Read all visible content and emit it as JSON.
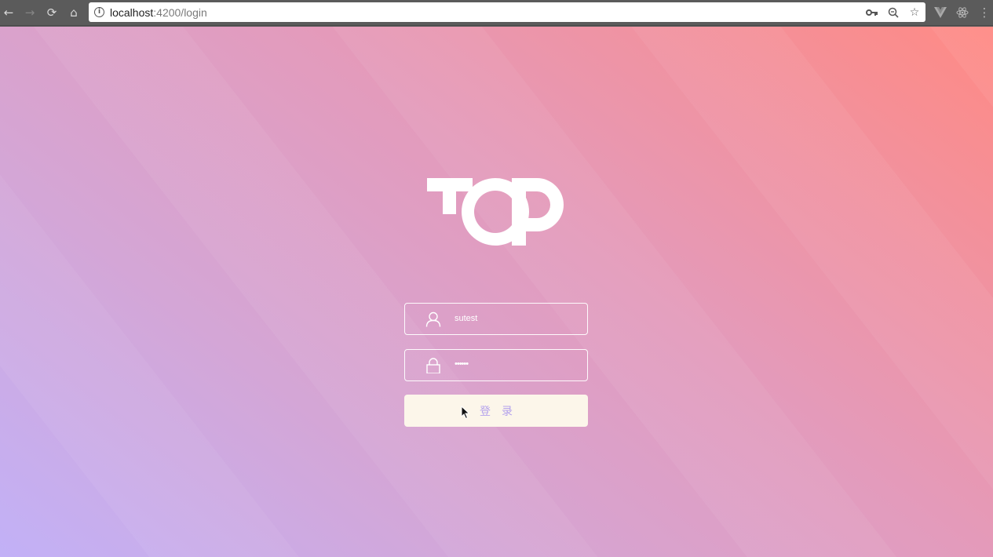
{
  "browser": {
    "url_host": "localhost",
    "url_path": ":4200/login",
    "back_icon": "arrow-left-icon",
    "forward_icon": "arrow-right-icon",
    "reload_icon": "reload-icon",
    "home_icon": "home-icon"
  },
  "login": {
    "logo_text": "TOP",
    "username": "sutest",
    "password_mask": "••••••",
    "submit_label": "登录"
  },
  "colors": {
    "gradient_start": "#c2b1f7",
    "gradient_end": "#ff8a84",
    "button_bg": "#fcf6ea",
    "button_text": "#b4a2ec"
  }
}
